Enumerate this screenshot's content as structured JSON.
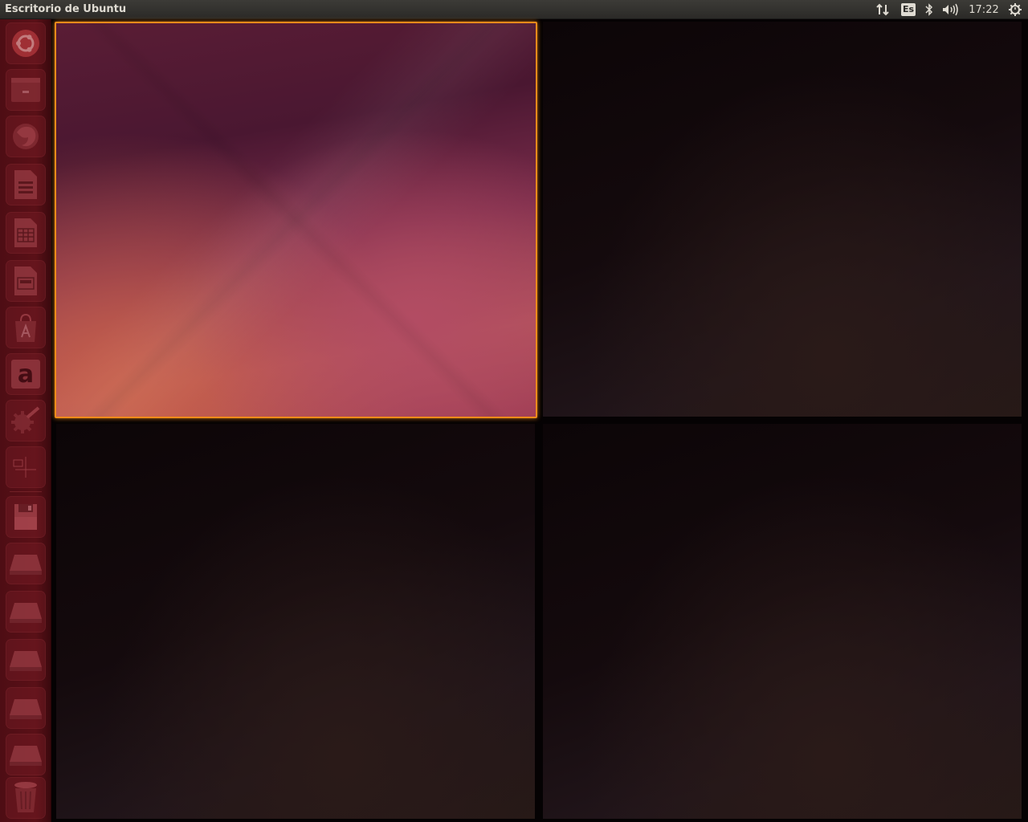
{
  "top_panel": {
    "title": "Escritorio de Ubuntu",
    "indicators": {
      "network_icon": "network-up-down-icon",
      "keyboard_layout": "Es",
      "bluetooth_icon": "bluetooth-icon",
      "sound_icon": "volume-icon",
      "clock": "17:22",
      "session_icon": "gear-power-icon"
    }
  },
  "launcher": {
    "items": [
      {
        "name": "dash-home",
        "icon": "ubuntu-logo-icon"
      },
      {
        "name": "files",
        "icon": "file-cabinet-icon"
      },
      {
        "name": "firefox",
        "icon": "firefox-icon"
      },
      {
        "name": "libreoffice-writer",
        "icon": "writer-document-icon"
      },
      {
        "name": "libreoffice-calc",
        "icon": "calc-spreadsheet-icon"
      },
      {
        "name": "libreoffice-impress",
        "icon": "impress-presentation-icon"
      },
      {
        "name": "ubuntu-software-center",
        "icon": "software-center-bag-icon"
      },
      {
        "name": "amazon",
        "icon": "amazon-icon"
      },
      {
        "name": "system-settings",
        "icon": "settings-gears-icon"
      },
      {
        "name": "workspace-switcher",
        "icon": "workspace-switcher-icon"
      },
      {
        "name": "floppy-drive",
        "icon": "floppy-drive-icon"
      },
      {
        "name": "drive-1",
        "icon": "hard-drive-icon"
      },
      {
        "name": "drive-2",
        "icon": "hard-drive-icon"
      },
      {
        "name": "drive-3",
        "icon": "hard-drive-icon"
      },
      {
        "name": "drive-4",
        "icon": "hard-drive-icon"
      },
      {
        "name": "drive-5",
        "icon": "hard-drive-icon"
      },
      {
        "name": "trash",
        "icon": "trash-icon"
      }
    ]
  },
  "workspaces": {
    "count": 4,
    "active_index": 1,
    "colors": {
      "active_border": "#f28b1a",
      "launcher_bg": "#5a1017",
      "panel_bg": "#3c3b37"
    }
  }
}
